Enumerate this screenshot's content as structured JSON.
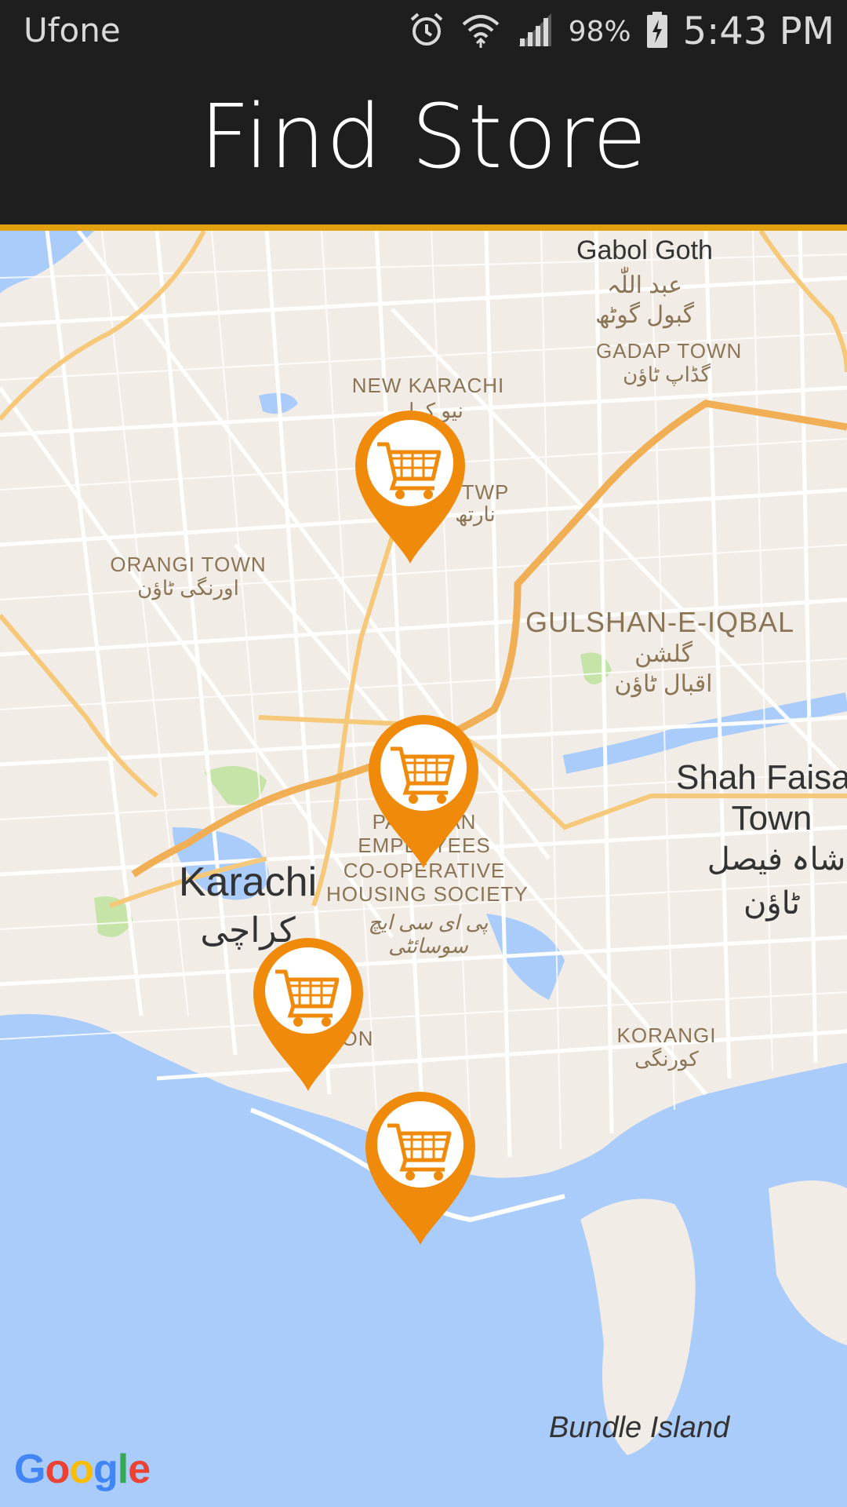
{
  "status_bar": {
    "carrier": "Ufone",
    "battery": "98%",
    "time": "5:43 PM",
    "icons": [
      "alarm-icon",
      "wifi-icon",
      "signal-icon",
      "battery-icon"
    ]
  },
  "app_bar": {
    "title": "Find Store"
  },
  "map": {
    "labels": {
      "gabol_goth": "Gabol Goth",
      "gabol_goth_urdu1": "عبد اللّٰہ",
      "gabol_goth_urdu2": "گبول گوٹھ",
      "gadap_town": "GADAP TOWN",
      "gadap_town_urdu": "گڈاپ ٹاؤن",
      "new_karachi": "NEW KARACHI",
      "new_karachi_urdu": "نیو کرا",
      "twp": "TWP",
      "twp_urdu": "نارتھ",
      "orangi_town": "ORANGI TOWN",
      "orangi_town_urdu": "اورنگی ٹاؤن",
      "gulshan": "GULSHAN-E-IQBAL",
      "gulshan_urdu1": "گلشن",
      "gulshan_urdu2": "اقبال ٹاؤن",
      "shah_faisal1": "Shah Faisa",
      "shah_faisal2": "Town",
      "shah_faisal_urdu1": "شاہ فیصل",
      "shah_faisal_urdu2": "ٹاؤن",
      "pechs1": "PAKISTAN",
      "pechs2": "EMPLOYEES",
      "pechs3": "CO-OPERATIVE",
      "pechs4": "HOUSING SOCIETY",
      "pechs_urdu1": "پی ای سی ایچ",
      "pechs_urdu2": "سوسائٹی",
      "karachi": "Karachi",
      "karachi_urdu": "کراچی",
      "saddar": "ON",
      "korangi": "KORANGI",
      "korangi_urdu": "کورنگی",
      "bundle_island": "Bundle Island"
    },
    "markers": [
      {
        "name": "store-marker-1",
        "icon": "shopping-cart-icon"
      },
      {
        "name": "store-marker-2",
        "icon": "shopping-cart-icon"
      },
      {
        "name": "store-marker-3",
        "icon": "shopping-cart-icon"
      },
      {
        "name": "store-marker-4",
        "icon": "shopping-cart-icon"
      }
    ],
    "attribution": "Google",
    "colors": {
      "land": "#f2ece6",
      "water": "#aaccfb",
      "road": "#ffffff",
      "highway": "#f6c97a",
      "park": "#c6e4a8",
      "marker": "#ef8a0a"
    }
  }
}
